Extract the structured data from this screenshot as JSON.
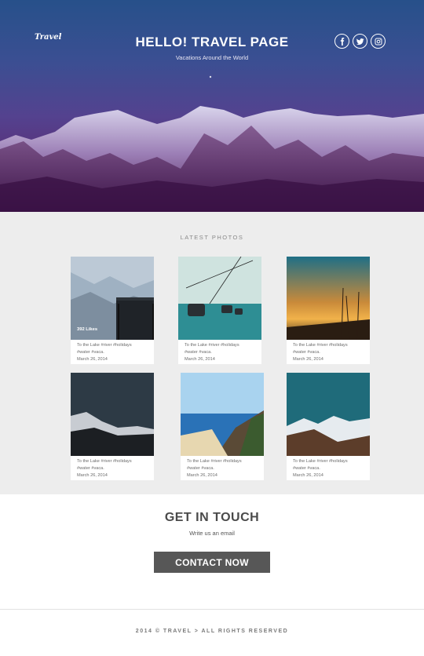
{
  "header": {
    "logo": "Travel",
    "title": "HELLO!  TRAVEL PAGE",
    "subtitle": "Vacations Around the World",
    "social": [
      {
        "name": "facebook-icon",
        "glyph": "f"
      },
      {
        "name": "twitter-icon",
        "glyph": "t"
      },
      {
        "name": "instagram-icon",
        "glyph": "ig"
      }
    ]
  },
  "photos": {
    "section_label": "LATEST PHOTOS",
    "items": [
      {
        "caption_1": "To the Lake #river #holidays",
        "caption_2": "#water #vaca.",
        "date": "March 26, 2014",
        "likes": "392 Likes"
      },
      {
        "caption_1": "To the Lake #river #holidays",
        "caption_2": "#water #vaca.",
        "date": "March 26, 2014"
      },
      {
        "caption_1": "To the Lake #river #holidays",
        "caption_2": "#water #vaca.",
        "date": "March 26, 2014"
      },
      {
        "caption_1": "To the Lake #river #holidays",
        "caption_2": "#water #vaca.",
        "date": "March 26, 2014"
      },
      {
        "caption_1": "To the Lake #river #holidays",
        "caption_2": "#water #vaca.",
        "date": "March 26, 2014"
      },
      {
        "caption_1": "To the Lake #river #holidays",
        "caption_2": "#water #vaca.",
        "date": "March 26, 2014"
      }
    ]
  },
  "contact": {
    "title": "GET IN TOUCH",
    "subtitle": "Write us an email",
    "button_label": "CONTACT NOW"
  },
  "footer": {
    "text": "2014  ©  TRAVEL > ALL RIGHTS RESERVED"
  },
  "colors": {
    "hero_top": "#27508a",
    "hero_bottom": "#3a1245",
    "section_bg": "#ededed",
    "button_bg": "#575757"
  }
}
